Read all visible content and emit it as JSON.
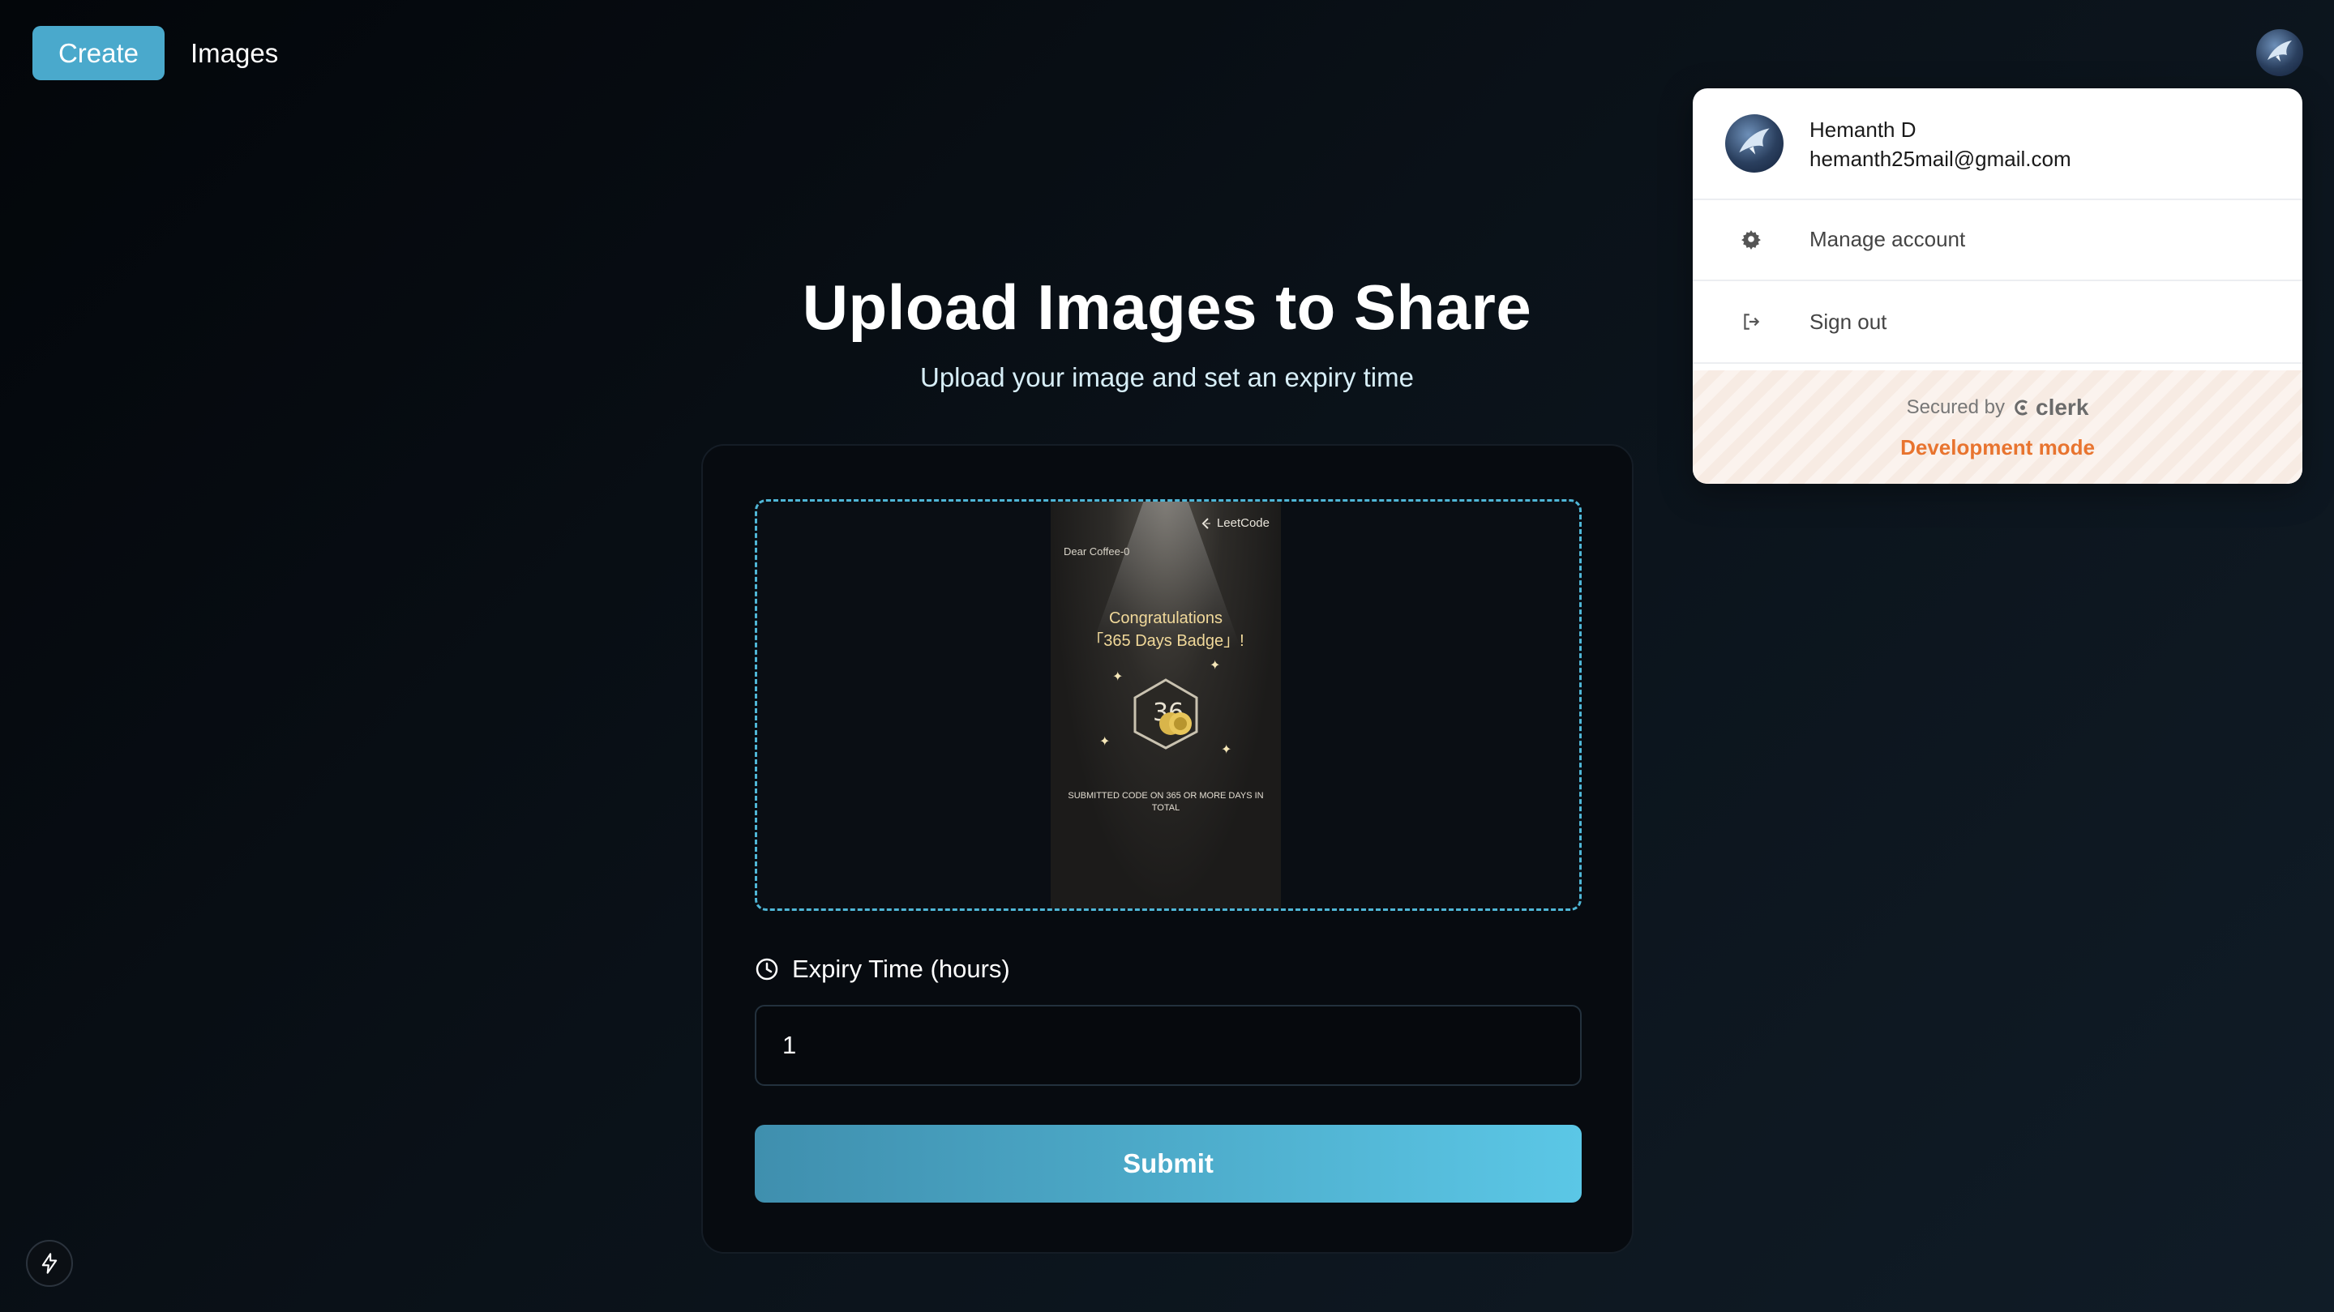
{
  "nav": {
    "create_label": "Create",
    "images_label": "Images"
  },
  "header": {
    "title": "Upload Images to Share",
    "subtitle": "Upload your image and set an expiry time"
  },
  "preview": {
    "brand": "LeetCode",
    "greeting": "Dear Coffee-0",
    "congrats_line1": "Congratulations",
    "congrats_line2": "「365 Days Badge」!",
    "footer": "SUBMITTED CODE ON 365 OR MORE DAYS IN TOTAL"
  },
  "form": {
    "expiry_label": "Expiry Time (hours)",
    "expiry_value": "1",
    "submit_label": "Submit"
  },
  "user_menu": {
    "name": "Hemanth D",
    "email": "hemanth25mail@gmail.com",
    "items": [
      {
        "label": "Manage account",
        "icon": "gear-icon"
      },
      {
        "label": "Sign out",
        "icon": "sign-out-icon"
      }
    ],
    "secured_by": "Secured by",
    "provider": "clerk",
    "mode": "Development mode"
  },
  "colors": {
    "accent": "#4aa9cc",
    "dashed_border": "#4fb6d6",
    "dev_mode": "#e8742f"
  }
}
